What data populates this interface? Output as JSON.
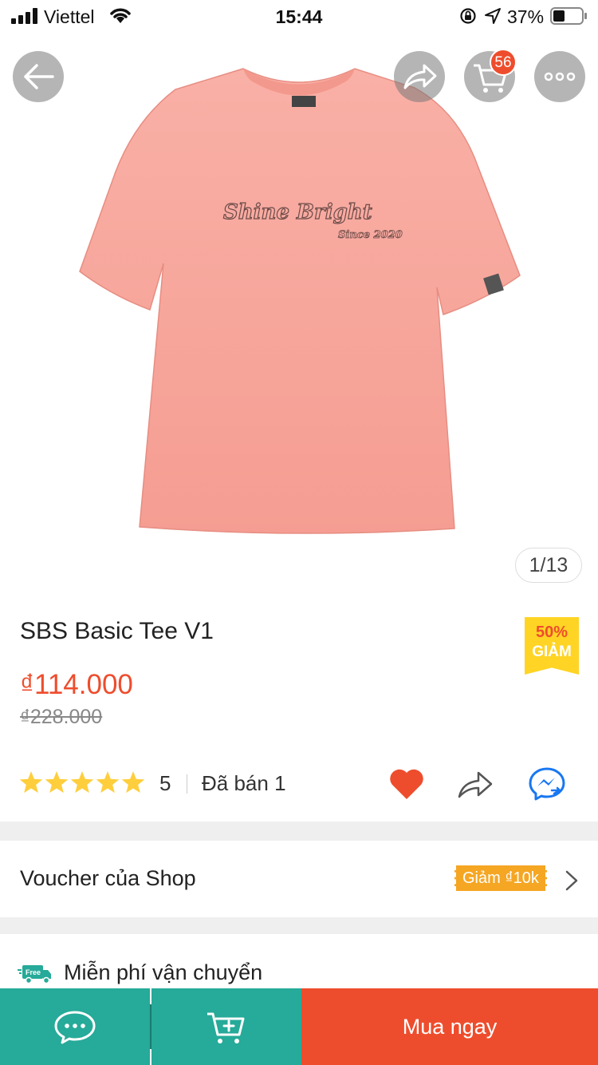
{
  "status_bar": {
    "carrier": "Viettel",
    "time": "15:44",
    "battery": "37%"
  },
  "header": {
    "back_icon": "arrow-left-icon",
    "share_icon": "share-icon",
    "cart_icon": "cart-icon",
    "cart_count": "56",
    "more_icon": "more-icon"
  },
  "gallery": {
    "counter": "1/13",
    "shirt_text_main": "Shine Bright",
    "shirt_text_sub": "Since 2020",
    "shirt_color": "#f7a59b"
  },
  "product": {
    "title": "SBS Basic Tee V1",
    "price": "₫114.000",
    "old_price": "₫228.000",
    "discount_pct": "50%",
    "discount_label": "GIẢM",
    "rating": 5,
    "rating_count": "5",
    "sold": "Đã bán 1"
  },
  "voucher": {
    "label": "Voucher của Shop",
    "chip": "Giảm ₫10k"
  },
  "shipping": {
    "label": "Miễn phí vận chuyển",
    "icon_text": "Free"
  },
  "bottom_bar": {
    "chat_icon": "chat-icon",
    "add_to_cart_icon": "add-to-cart-icon",
    "buy_label": "Mua ngay"
  },
  "colors": {
    "accent": "#ee4d2d",
    "teal": "#26aa99",
    "star": "#ffce3d"
  }
}
